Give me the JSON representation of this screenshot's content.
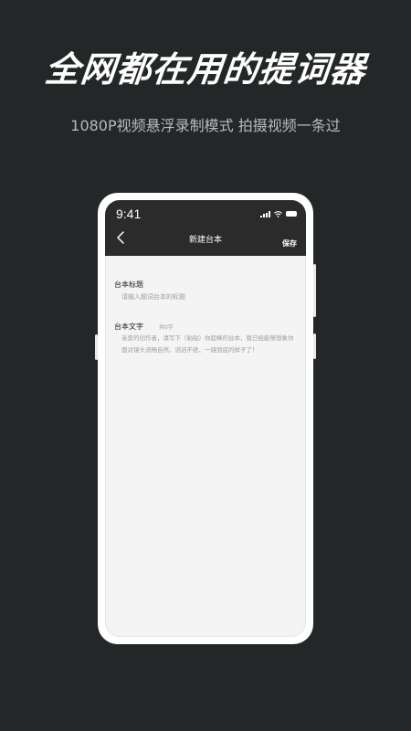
{
  "promo": {
    "headline": "全网都在用的提词器",
    "subline": "1080P视频悬浮录制模式 拍摄视频一条过"
  },
  "status_bar": {
    "time": "9:41"
  },
  "nav": {
    "title": "新建台本",
    "save_label": "保存",
    "back_icon": "chevron-left-icon"
  },
  "form": {
    "title_label": "台本标题",
    "title_placeholder": "请输入题词台本的标题",
    "title_value": "",
    "body_label": "台本文字",
    "char_count": "共0字",
    "body_placeholder": "亲爱的创作者，请写下（粘贴）你超棒的台本，我已经能够想象你面对镜头流畅自然、滔滔不绝、一镜到底的样子了！",
    "body_value": ""
  },
  "colors": {
    "background": "#242728",
    "app_header": "#2b2b2b",
    "screen_bg": "#f4f4f4"
  }
}
